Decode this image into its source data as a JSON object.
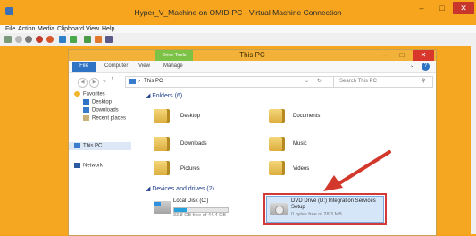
{
  "vm": {
    "title": "Hyper_V_Machine on OMID-PC - Virtual Machine Connection",
    "menu": [
      "File",
      "Action",
      "Media",
      "Clipboard",
      "View",
      "Help"
    ],
    "min": "–",
    "max": "□",
    "close": "✕"
  },
  "explorer": {
    "title": "This PC",
    "contextual_tab": "Drive Tools",
    "ribbon_tabs": [
      "File",
      "Computer",
      "View",
      "Manage"
    ],
    "address": "This PC",
    "search_placeholder": "Search This PC",
    "nav": {
      "favorites": "Favorites",
      "desktop": "Desktop",
      "downloads": "Downloads",
      "recent": "Recent places",
      "thispc": "This PC",
      "network": "Network"
    },
    "folders_header": "Folders (6)",
    "folders": [
      "Desktop",
      "Documents",
      "Downloads",
      "Music",
      "Pictures",
      "Videos"
    ],
    "devices_header": "Devices and drives (2)",
    "local_disk": {
      "name": "Local Disk (C:)",
      "free": "33.8 GB free of 44.4 GB",
      "used_fraction": 0.24
    },
    "dvd": {
      "name": "DVD Drive (D:) Integration Services",
      "name2": "Setup",
      "free": "0 bytes free of 28.3 MB"
    }
  },
  "colors": {
    "accent": "#2f73c4",
    "highlight_box": "#d23a3a",
    "title_bar": "#f7a51f"
  }
}
